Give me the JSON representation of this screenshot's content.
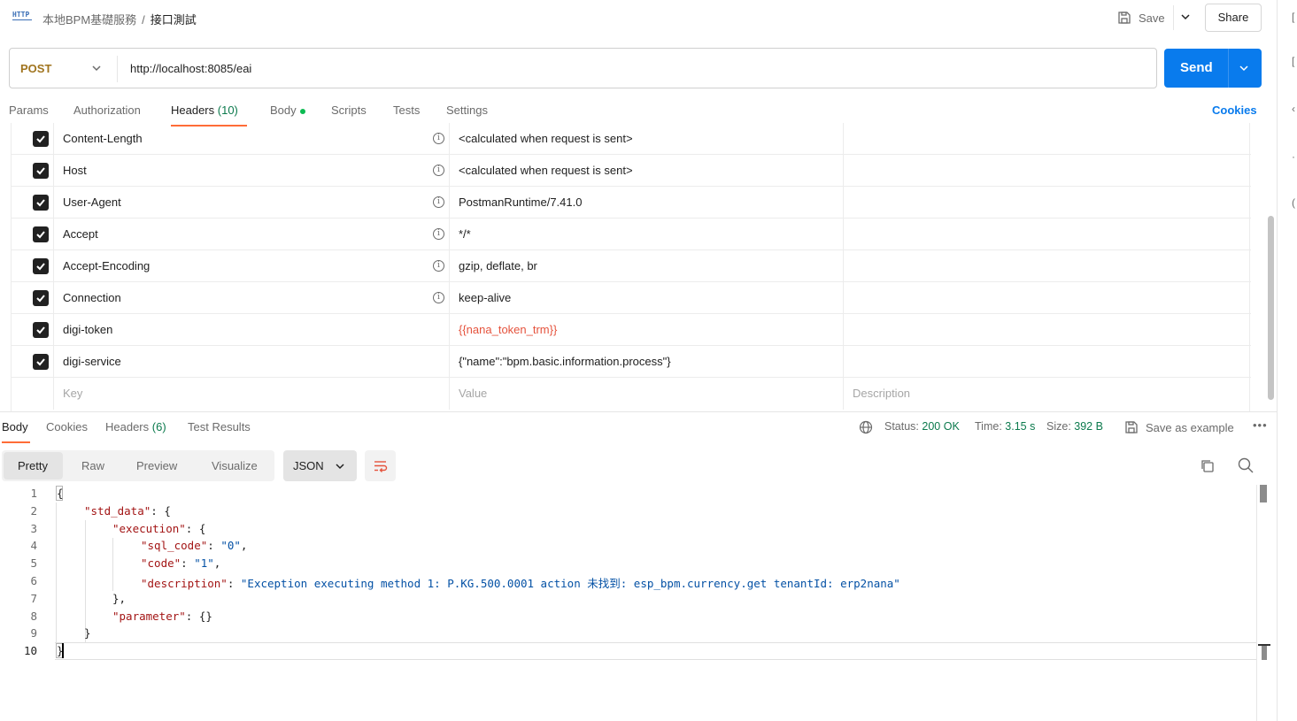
{
  "topbar": {
    "app_icon_label": "HTTP",
    "breadcrumb_parent": "本地BPM基礎服務",
    "breadcrumb_sep": "/",
    "breadcrumb_current": "接口測試",
    "save_label": "Save",
    "share_label": "Share"
  },
  "request": {
    "method": "POST",
    "url": "http://localhost:8085/eai",
    "send_label": "Send"
  },
  "request_tabs": {
    "params": "Params",
    "authorization": "Authorization",
    "headers": "Headers",
    "headers_count": "(10)",
    "body": "Body",
    "scripts": "Scripts",
    "tests": "Tests",
    "settings": "Settings",
    "cookies": "Cookies"
  },
  "headers": [
    {
      "key": "Content-Length",
      "value": "<calculated when request is sent>",
      "checked": true,
      "auto": true
    },
    {
      "key": "Host",
      "value": "<calculated when request is sent>",
      "checked": true,
      "auto": true
    },
    {
      "key": "User-Agent",
      "value": "PostmanRuntime/7.41.0",
      "checked": true,
      "auto": true
    },
    {
      "key": "Accept",
      "value": "*/*",
      "checked": true,
      "auto": true
    },
    {
      "key": "Accept-Encoding",
      "value": "gzip, deflate, br",
      "checked": true,
      "auto": true
    },
    {
      "key": "Connection",
      "value": "keep-alive",
      "checked": true,
      "auto": true
    },
    {
      "key": "digi-token",
      "value": "{{nana_token_trm}}",
      "checked": true,
      "auto": false
    },
    {
      "key": "digi-service",
      "value": "{\"name\":\"bpm.basic.information.process\"}",
      "checked": true,
      "auto": false
    }
  ],
  "headers_placeholder": {
    "key": "Key",
    "value": "Value",
    "description": "Description"
  },
  "response_tabs": {
    "body": "Body",
    "cookies": "Cookies",
    "headers": "Headers",
    "headers_count": "(6)",
    "test_results": "Test Results"
  },
  "response_meta": {
    "status_label": "Status:",
    "status_value": "200 OK",
    "time_label": "Time:",
    "time_value": "3.15 s",
    "size_label": "Size:",
    "size_value": "392 B",
    "save_example": "Save as example",
    "more": "•••"
  },
  "format_bar": {
    "pretty": "Pretty",
    "raw": "Raw",
    "preview": "Preview",
    "visualize": "Visualize",
    "language": "JSON"
  },
  "response_body": {
    "line_numbers": [
      "1",
      "2",
      "3",
      "4",
      "5",
      "6",
      "7",
      "8",
      "9",
      "10"
    ],
    "l1": "{",
    "l2_key": "\"std_data\"",
    "l2_rest": ": {",
    "l3_key": "\"execution\"",
    "l3_rest": ": {",
    "l4_key": "\"sql_code\"",
    "l4_sep": ": ",
    "l4_val": "\"0\"",
    "l4_end": ",",
    "l5_key": "\"code\"",
    "l5_sep": ": ",
    "l5_val": "\"1\"",
    "l5_end": ",",
    "l6_key": "\"description\"",
    "l6_sep": ": ",
    "l6_val": "\"Exception executing method 1: P.KG.500.0001 action 未找到: esp_bpm.currency.get tenantId: erp2nana\"",
    "l7": "},",
    "l8_key": "\"parameter\"",
    "l8_rest": ": {}",
    "l9": "}",
    "l10": "}"
  },
  "colors": {
    "accent": "#ff6c37",
    "send_blue": "#097bed",
    "status_green": "#0c7a4d",
    "variable_red": "#e5533d",
    "method_post": "#a0741e"
  }
}
